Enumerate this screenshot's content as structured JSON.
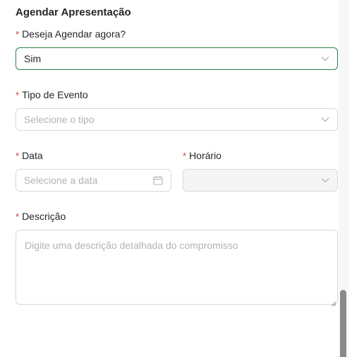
{
  "section": {
    "title": "Agendar Apresentação"
  },
  "form": {
    "required_mark": "*",
    "schedule_now": {
      "label": "Deseja Agendar agora?",
      "value": "Sim"
    },
    "event_type": {
      "label": "Tipo de Evento",
      "placeholder": "Selecione o tipo"
    },
    "date": {
      "label": "Data",
      "placeholder": "Selecione a data"
    },
    "time": {
      "label": "Horário",
      "value": ""
    },
    "description": {
      "label": "Descrição",
      "placeholder": "Digite uma descrição detalhada do compromisso"
    }
  },
  "icons": {
    "select_arrow": "chevron-down-icon",
    "date_picker": "calendar-icon",
    "resize": "resize-grip-icon"
  },
  "colors": {
    "required": "#e0312f",
    "active_border": "#2e7d47",
    "placeholder": "#b3b3b3",
    "border": "#d9d9d9",
    "scroll_thumb": "#8a8a8a"
  }
}
